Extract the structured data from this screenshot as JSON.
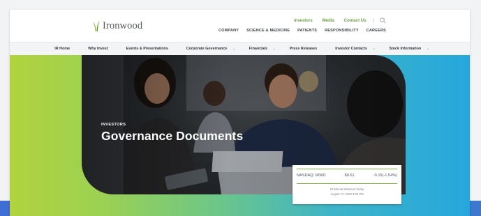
{
  "brand": {
    "name": "Ironwood"
  },
  "utility_nav": [
    "Investors",
    "Media",
    "Contact Us"
  ],
  "utility_separator": "|",
  "main_nav": [
    "COMPANY",
    "SCIENCE & MEDICINE",
    "PATIENTS",
    "RESPONSIBILITY",
    "CAREERS"
  ],
  "sub_nav": [
    {
      "label": "IR Home",
      "caret": ""
    },
    {
      "label": "Why Invest",
      "caret": ""
    },
    {
      "label": "Events & Presentations",
      "caret": ""
    },
    {
      "label": "Corporate Governance",
      "caret": "⌄"
    },
    {
      "label": "Financials",
      "caret": "⌄"
    },
    {
      "label": "Press Releases",
      "caret": ""
    },
    {
      "label": "Investor Contacts",
      "caret": "⌄"
    },
    {
      "label": "Stock Information",
      "caret": "⌄"
    }
  ],
  "hero": {
    "eyebrow": "INVESTORS",
    "title": "Governance Documents"
  },
  "stock": {
    "ticker": "NASDAQ: IRWD",
    "price": "$9.61",
    "change": "-0.15(-1.54%)",
    "delay_note": "20 Minute Minimum Delay",
    "timestamp": "August 17, 2023 3:02 PM"
  },
  "colors": {
    "accent_green": "#6ba343",
    "gradient_start": "#b1d33e",
    "gradient_end": "#26a7dc",
    "bottom_bar": "#3f6fd6"
  }
}
